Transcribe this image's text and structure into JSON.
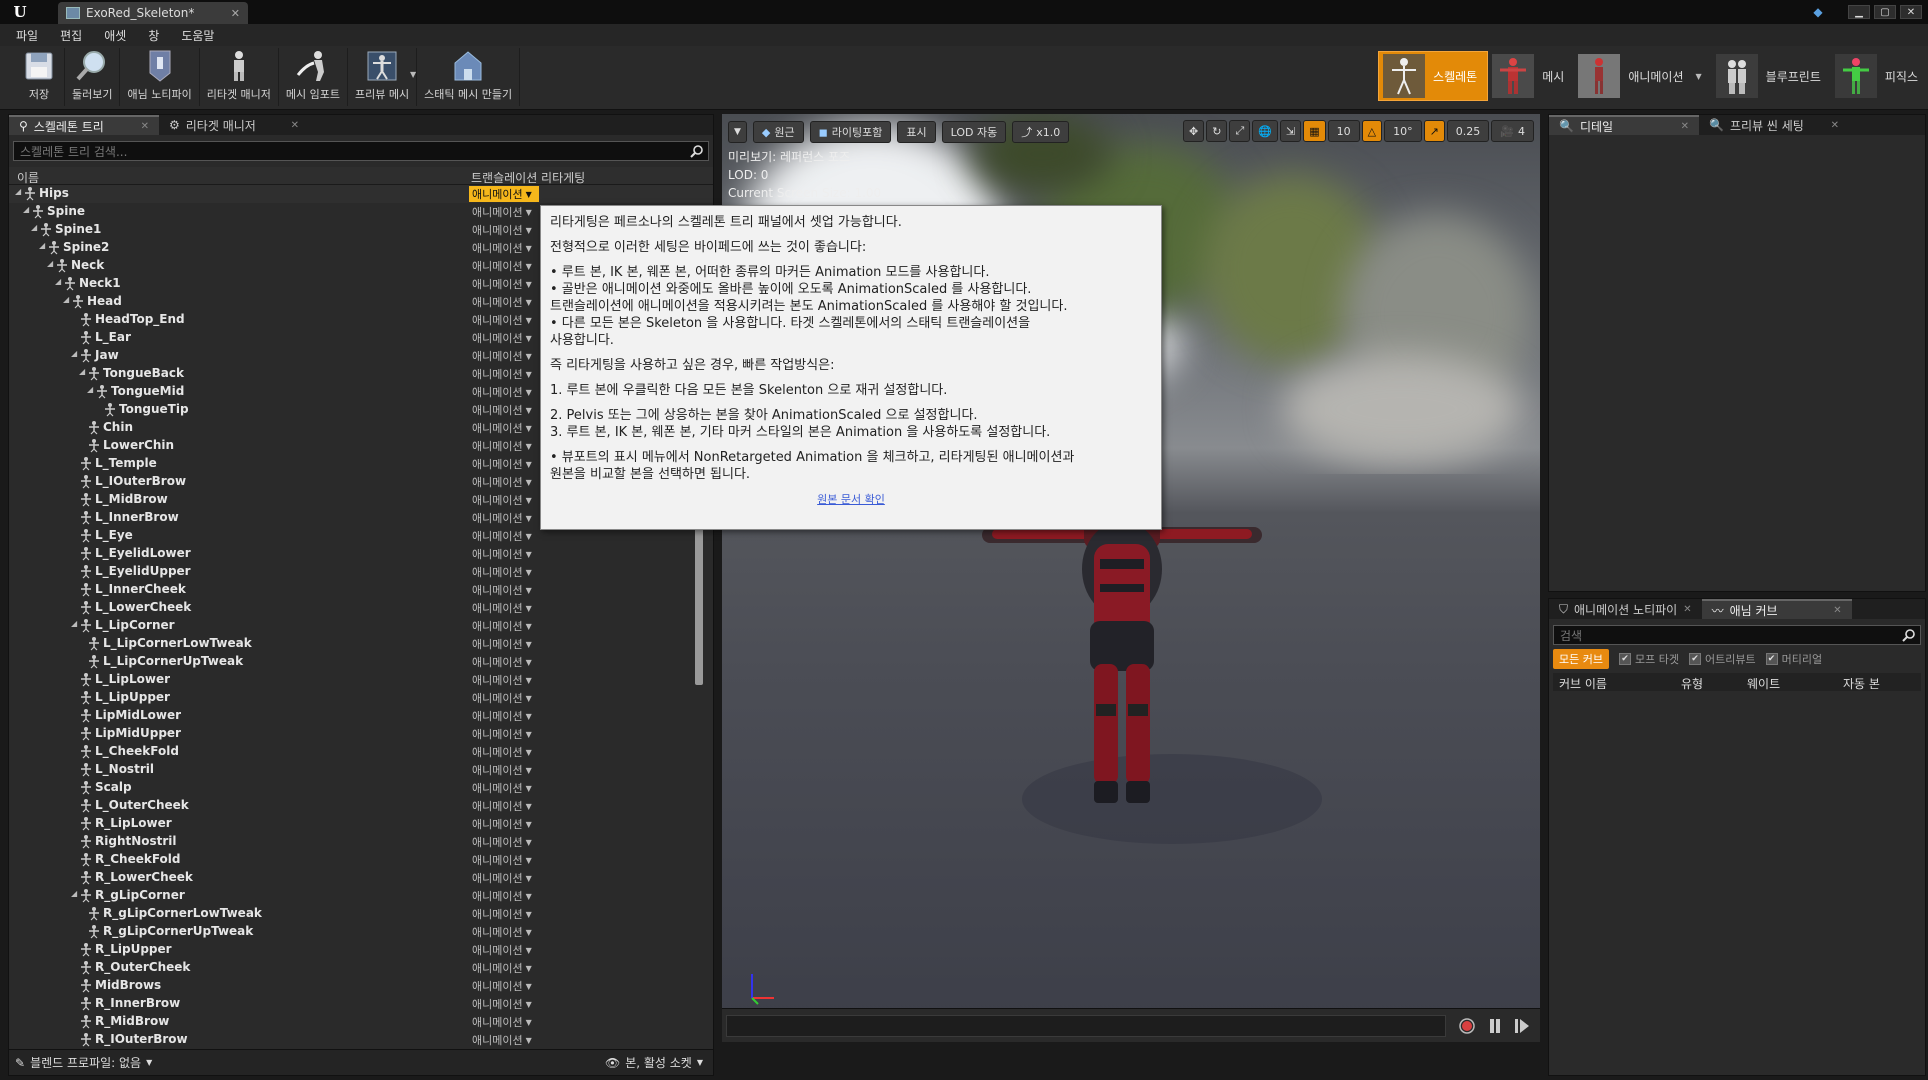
{
  "window": {
    "doc_tab": "ExoRed_Skeleton*",
    "logo": "U"
  },
  "menu": [
    "파일",
    "편집",
    "애셋",
    "창",
    "도움말"
  ],
  "toolbar": {
    "buttons": [
      {
        "label": "저장",
        "icon": "save-icon"
      },
      {
        "label": "둘러보기",
        "icon": "browse-icon"
      },
      {
        "label": "애님 노티파이",
        "icon": "anim-notify-icon"
      },
      {
        "label": "리타겟 매니저",
        "icon": "retarget-manager-icon"
      },
      {
        "label": "메시 임포트",
        "icon": "import-mesh-icon"
      },
      {
        "label": "프리뷰 메시",
        "icon": "preview-mesh-icon"
      },
      {
        "label": "스태틱 메시 만들기",
        "icon": "make-static-mesh-icon"
      }
    ],
    "modes": [
      {
        "label": "스켈레톤",
        "active": true
      },
      {
        "label": "메시",
        "active": false
      },
      {
        "label": "애니메이션",
        "active": false
      },
      {
        "label": "블루프린트",
        "active": false
      },
      {
        "label": "피직스",
        "active": false
      }
    ]
  },
  "left_panel": {
    "tabs": [
      "스켈레톤 트리",
      "리타겟 매니저"
    ],
    "search_placeholder": "스켈레톤 트리 검색...",
    "col_name": "이름",
    "col_retarget": "트랜슬레이션 리타게팅",
    "mode_value": "애니메이션",
    "bones": [
      {
        "name": "Hips",
        "level": 0,
        "expanded": true
      },
      {
        "name": "Spine",
        "level": 1,
        "expanded": true
      },
      {
        "name": "Spine1",
        "level": 2,
        "expanded": true
      },
      {
        "name": "Spine2",
        "level": 3,
        "expanded": true
      },
      {
        "name": "Neck",
        "level": 4,
        "expanded": true
      },
      {
        "name": "Neck1",
        "level": 5,
        "expanded": true
      },
      {
        "name": "Head",
        "level": 6,
        "expanded": true
      },
      {
        "name": "HeadTop_End",
        "level": 7,
        "expanded": false
      },
      {
        "name": "L_Ear",
        "level": 7,
        "expanded": false
      },
      {
        "name": "Jaw",
        "level": 7,
        "expanded": true
      },
      {
        "name": "TongueBack",
        "level": 8,
        "expanded": true
      },
      {
        "name": "TongueMid",
        "level": 9,
        "expanded": true
      },
      {
        "name": "TongueTip",
        "level": 10,
        "expanded": false
      },
      {
        "name": "Chin",
        "level": 8,
        "expanded": false
      },
      {
        "name": "LowerChin",
        "level": 8,
        "expanded": false
      },
      {
        "name": "L_Temple",
        "level": 7,
        "expanded": false
      },
      {
        "name": "L_IOuterBrow",
        "level": 7,
        "expanded": false
      },
      {
        "name": "L_MidBrow",
        "level": 7,
        "expanded": false
      },
      {
        "name": "L_InnerBrow",
        "level": 7,
        "expanded": false
      },
      {
        "name": "L_Eye",
        "level": 7,
        "expanded": false
      },
      {
        "name": "L_EyelidLower",
        "level": 7,
        "expanded": false
      },
      {
        "name": "L_EyelidUpper",
        "level": 7,
        "expanded": false
      },
      {
        "name": "L_InnerCheek",
        "level": 7,
        "expanded": false
      },
      {
        "name": "L_LowerCheek",
        "level": 7,
        "expanded": false
      },
      {
        "name": "L_LipCorner",
        "level": 7,
        "expanded": true
      },
      {
        "name": "L_LipCornerLowTweak",
        "level": 8,
        "expanded": false
      },
      {
        "name": "L_LipCornerUpTweak",
        "level": 8,
        "expanded": false
      },
      {
        "name": "L_LipLower",
        "level": 7,
        "expanded": false
      },
      {
        "name": "L_LipUpper",
        "level": 7,
        "expanded": false
      },
      {
        "name": "LipMidLower",
        "level": 7,
        "expanded": false
      },
      {
        "name": "LipMidUpper",
        "level": 7,
        "expanded": false
      },
      {
        "name": "L_CheekFold",
        "level": 7,
        "expanded": false
      },
      {
        "name": "L_Nostril",
        "level": 7,
        "expanded": false
      },
      {
        "name": "Scalp",
        "level": 7,
        "expanded": false
      },
      {
        "name": "L_OuterCheek",
        "level": 7,
        "expanded": false
      },
      {
        "name": "R_LipLower",
        "level": 7,
        "expanded": false
      },
      {
        "name": "RightNostril",
        "level": 7,
        "expanded": false
      },
      {
        "name": "R_CheekFold",
        "level": 7,
        "expanded": false
      },
      {
        "name": "R_LowerCheek",
        "level": 7,
        "expanded": false
      },
      {
        "name": "R_gLipCorner",
        "level": 7,
        "expanded": true
      },
      {
        "name": "R_gLipCornerLowTweak",
        "level": 8,
        "expanded": false
      },
      {
        "name": "R_gLipCornerUpTweak",
        "level": 8,
        "expanded": false
      },
      {
        "name": "R_LipUpper",
        "level": 7,
        "expanded": false
      },
      {
        "name": "R_OuterCheek",
        "level": 7,
        "expanded": false
      },
      {
        "name": "MidBrows",
        "level": 7,
        "expanded": false
      },
      {
        "name": "R_InnerBrow",
        "level": 7,
        "expanded": false
      },
      {
        "name": "R_MidBrow",
        "level": 7,
        "expanded": false
      },
      {
        "name": "R_IOuterBrow",
        "level": 7,
        "expanded": false
      }
    ],
    "blend_profile": "블렌드 프로파일: 없음",
    "bone_filter": "본, 활성 소켓"
  },
  "viewport": {
    "view_mode": "원근",
    "lighting": "라이팅포함",
    "show": "표시",
    "lod": "LOD 자동",
    "speed": "x1.0",
    "grid_snap": "10",
    "angle_snap": "10°",
    "scale_snap": "0.25",
    "camera_speed": "4",
    "preview_label": "미리보기: 레퍼런스 포즈",
    "lod_line": "LOD: 0",
    "screen_size": "Current Screen Size: 1.00"
  },
  "tooltip": {
    "p1": "리타게팅은 페르소나의 스켈레톤 트리 패널에서 셋업 가능합니다.",
    "p2": "전형적으로 이러한 세팅은 바이페드에 쓰는 것이 좋습니다:",
    "b1": "• 루트 본, IK 본, 웨폰 본, 어떠한 종류의 마커든 Animation 모드를 사용합니다.",
    "b2": "• 골반은 애니메이션 와중에도 올바른 높이에 오도록 AnimationScaled 를 사용합니다.",
    "b2b": "트랜슬레이션에 애니메이션을 적용시키려는 본도 AnimationScaled 를 사용해야 할 것입니다.",
    "b3": "• 다른 모든 본은 Skeleton 을 사용합니다. 타겟 스켈레톤에서의 스태틱 트랜슬레이션을",
    "b3b": "사용합니다.",
    "p3": "즉 리타게팅을 사용하고 싶은 경우, 빠른 작업방식은:",
    "s1": "1. 루트 본에 우클릭한 다음 모든 본을 Skelenton 으로 재귀 설정합니다.",
    "s2": "2. Pelvis 또는 그에 상응하는 본을 찾아 AnimationScaled 으로 설정합니다.",
    "s3": "3. 루트 본, IK 본, 웨폰 본, 기타 마커 스타일의 본은 Animation 을 사용하도록 설정합니다.",
    "b4": "• 뷰포트의 표시 메뉴에서 NonRetargeted Animation 을 체크하고, 리타게팅된 애니메이션과",
    "b4b": "원본을 비교할 본을 선택하면 됩니다.",
    "link": "원본 문서 확인"
  },
  "right_top": {
    "tabs": [
      "디테일",
      "프리뷰 씬 세팅"
    ]
  },
  "right_bottom": {
    "tabs": [
      "애니메이션 노티파이",
      "애님 커브"
    ],
    "search_placeholder": "검색",
    "filter_all": "모든 커브",
    "filters": [
      "모프 타겟",
      "어트리뷰트",
      "머티리얼"
    ],
    "columns": [
      "커브 이름",
      "유형",
      "웨이트",
      "자동 본"
    ]
  },
  "colors": {
    "accent": "#e38a08",
    "selected_mode": "#f6b71b",
    "panel_bg": "#2a2a2a",
    "record": "#d94040"
  }
}
